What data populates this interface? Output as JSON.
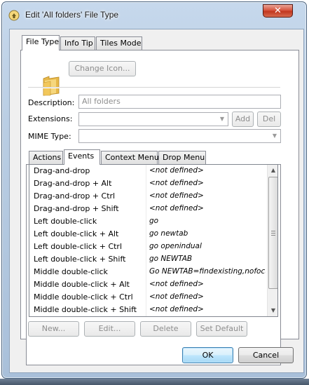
{
  "window": {
    "title": "Edit 'All folders' File Type",
    "close_glyph": "✕"
  },
  "main_tabs": [
    {
      "label": "File Type",
      "active": true
    },
    {
      "label": "Info Tip",
      "active": false
    },
    {
      "label": "Tiles Mode",
      "active": false
    }
  ],
  "file_type": {
    "icon": "folder-icon",
    "change_icon_label": "Change Icon...",
    "description_label": "Description:",
    "description_value": "All folders",
    "extensions_label": "Extensions:",
    "extensions_value": "",
    "add_label": "Add",
    "del_label": "Del",
    "mime_label": "MIME Type:",
    "mime_value": ""
  },
  "sub_tabs": [
    {
      "label": "Actions",
      "active": false
    },
    {
      "label": "Events",
      "active": true
    },
    {
      "label": "Context Menu",
      "active": false
    },
    {
      "label": "Drop Menu",
      "active": false
    }
  ],
  "events": [
    {
      "event": "Drag-and-drop",
      "command": "<not defined>"
    },
    {
      "event": "Drag-and-drop + Alt",
      "command": "<not defined>"
    },
    {
      "event": "Drag-and-drop + Ctrl",
      "command": "<not defined>"
    },
    {
      "event": "Drag-and-drop + Shift",
      "command": "<not defined>"
    },
    {
      "event": "Left double-click",
      "command": "go"
    },
    {
      "event": "Left double-click + Alt",
      "command": "go newtab"
    },
    {
      "event": "Left double-click + Ctrl",
      "command": "go openindual"
    },
    {
      "event": "Left double-click + Shift",
      "command": "go NEWTAB"
    },
    {
      "event": "Middle double-click",
      "command": "Go NEWTAB=findexisting,nofocus..."
    },
    {
      "event": "Middle double-click + Alt",
      "command": "<not defined>"
    },
    {
      "event": "Middle double-click + Ctrl",
      "command": "<not defined>"
    },
    {
      "event": "Middle double-click + Shift",
      "command": "<not defined>"
    }
  ],
  "event_buttons": {
    "new_label": "New...",
    "edit_label": "Edit...",
    "delete_label": "Delete",
    "set_default_label": "Set Default"
  },
  "dialog_buttons": {
    "ok_label": "OK",
    "cancel_label": "Cancel"
  }
}
